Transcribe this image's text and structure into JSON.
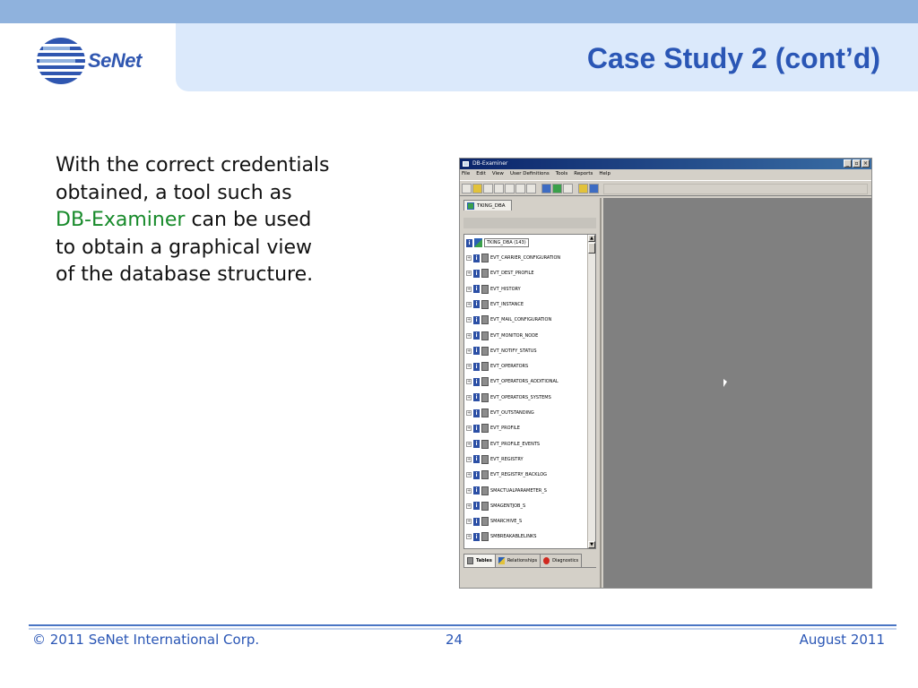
{
  "header": {
    "title": "Case Study 2 (cont’d)",
    "logo_text": "SeNet"
  },
  "content": {
    "line1": "With the correct credentials",
    "line2": "obtained, a tool such as",
    "line3_highlight": "DB-Examiner",
    "line3_rest": " can be used",
    "line4": "to obtain a graphical view",
    "line5": "of the database structure."
  },
  "app": {
    "window_title": "DB-Examiner",
    "window_buttons": [
      "_",
      "▫",
      "×"
    ],
    "menu": [
      "File",
      "Edit",
      "View",
      "User Definitions",
      "Tools",
      "Reports",
      "Help"
    ],
    "db_tab": "TKING_DBA",
    "root_node": "TKING_DBA (143)",
    "tables": [
      "EVT_CARRIER_CONFIGURATION",
      "EVT_DEST_PROFILE",
      "EVT_HISTORY",
      "EVT_INSTANCE",
      "EVT_MAIL_CONFIGURATION",
      "EVT_MONITOR_NODE",
      "EVT_NOTIFY_STATUS",
      "EVT_OPERATORS",
      "EVT_OPERATORS_ADDITIONAL",
      "EVT_OPERATORS_SYSTEMS",
      "EVT_OUTSTANDING",
      "EVT_PROFILE",
      "EVT_PROFILE_EVENTS",
      "EVT_REGISTRY",
      "EVT_REGISTRY_BACKLOG",
      "SMACTUALPARAMETER_S",
      "SMAGENTJOB_S",
      "SMARCHIVE_S",
      "SMBREAKABLELINKS"
    ],
    "bottom_tabs": [
      "Tables",
      "Relationships",
      "Diagnostics"
    ],
    "icons": {
      "expander": "+",
      "info": "i"
    }
  },
  "footer": {
    "copyright": "© 2011 SeNet International Corp.",
    "page": "24",
    "date": "August 2011"
  },
  "colors": {
    "title_blue": "#2a56b5",
    "highlight_green": "#178a2a",
    "header_band": "#8fb2dd",
    "title_panel": "#dbe9fb"
  }
}
